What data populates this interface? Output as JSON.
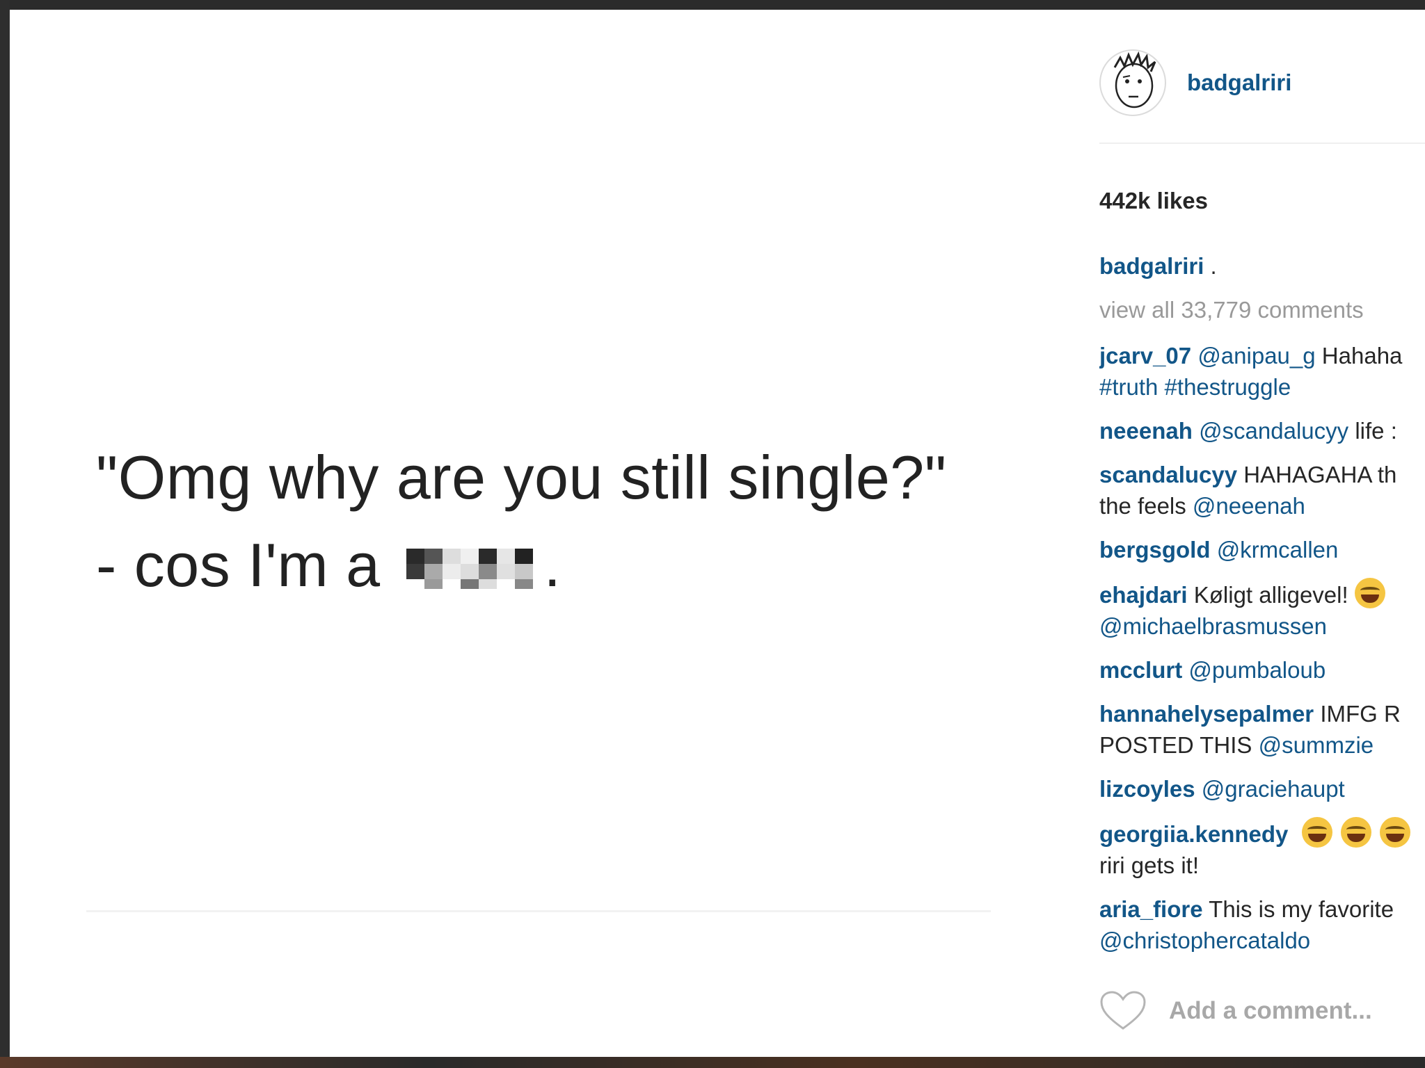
{
  "post": {
    "image_text": {
      "line1": "\"Omg why are you still single?\"",
      "line2_prefix": "- cos I'm a",
      "line2_suffix": "."
    }
  },
  "header": {
    "username": "badgalriri",
    "avatar_icon": "cartoon-face-avatar"
  },
  "likes": "442k likes",
  "caption": {
    "username": "badgalriri",
    "text": "."
  },
  "view_all": "view all 33,779 comments",
  "comments": [
    {
      "user": "jcarv_07",
      "mention": "@anipau_g",
      "text": "Hahaha",
      "line2": "#truth #thestruggle"
    },
    {
      "user": "neeenah",
      "mention": "@scandalucyy",
      "text": "life :",
      "line2": ""
    },
    {
      "user": "scandalucyy",
      "mention": "",
      "text": "HAHAGAHA th",
      "line2_text": "the feels",
      "line2": "@neeenah"
    },
    {
      "user": "bergsgold",
      "mention": "@krmcallen",
      "text": "",
      "line2": ""
    },
    {
      "user": "ehajdari",
      "mention": "",
      "text": "Køligt alligevel!",
      "line2": "@michaelbrasmussen"
    },
    {
      "user": "mcclurt",
      "mention": "@pumbaloub",
      "text": "",
      "line2": ""
    },
    {
      "user": "hannahelysepalmer",
      "mention": "",
      "text": "IMFG R",
      "line2_text": "POSTED THIS",
      "line2": "@summzie"
    },
    {
      "user": "lizcoyles",
      "mention": "@graciehaupt",
      "text": "",
      "line2": ""
    },
    {
      "user": "georgiia.kennedy",
      "mention": "",
      "text": "",
      "line2_text": "riri gets it!",
      "line2": ""
    },
    {
      "user": "aria_fiore",
      "mention": "",
      "text": "This is my favorite",
      "line2": "@christophercataldo"
    }
  ],
  "comment_input": {
    "placeholder": "Add a comment..."
  },
  "colors": {
    "username": "#125688",
    "text": "#262626",
    "muted": "#999999"
  }
}
